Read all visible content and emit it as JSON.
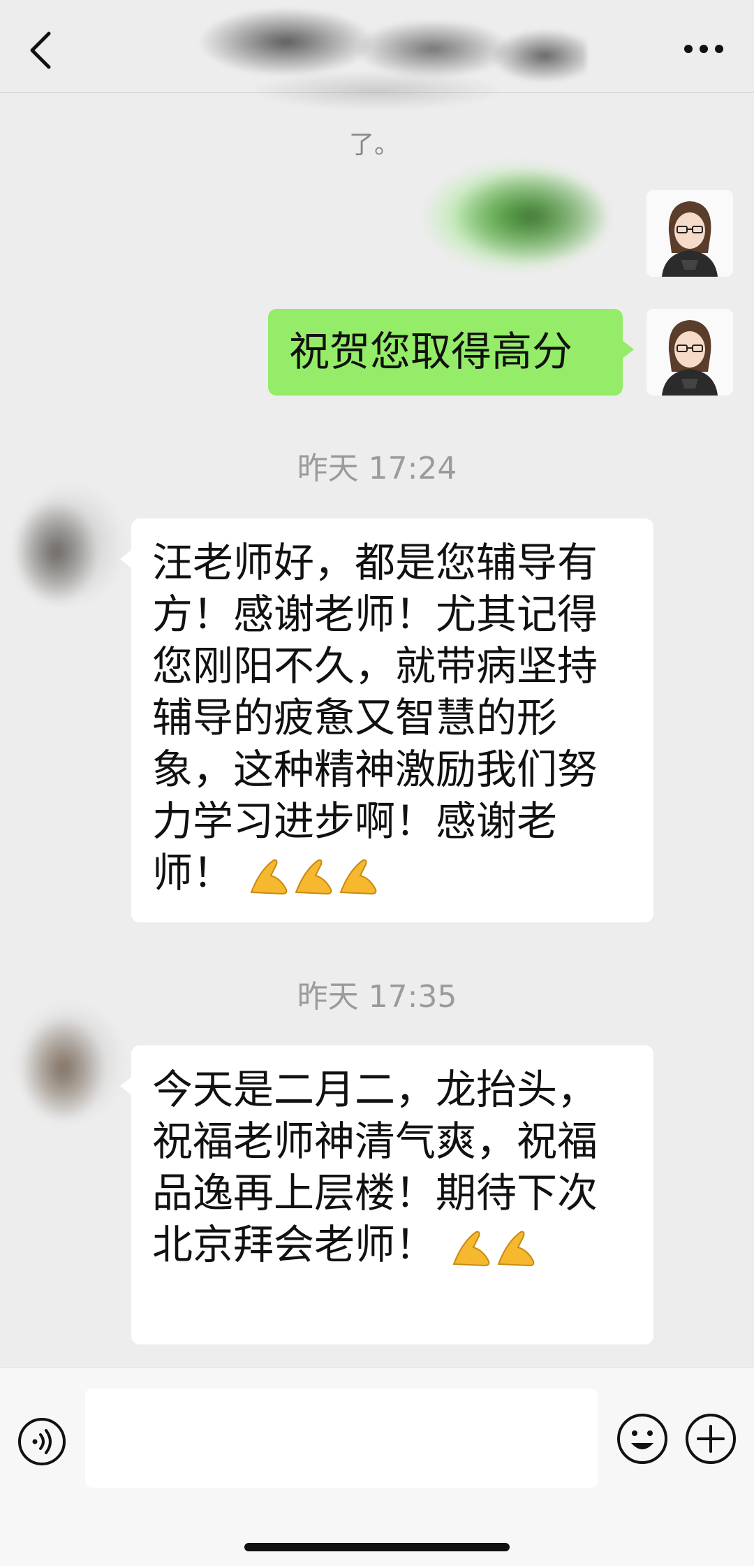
{
  "nav": {
    "back_icon": "chevron-left-icon",
    "more_icon": "more-dots-icon"
  },
  "clipped_text": "了。",
  "messages": {
    "outgoing_1_hidden_icon": "obscured-message",
    "outgoing_2": "祝贺您取得高分",
    "timestamp_1": "昨天 17:24",
    "incoming_1": "汪老师好，都是您辅导有方！感谢老师！尤其记得您刚阳不久，就带病坚持辅导的疲惫又智慧的形象，这种精神激励我们努力学习进步啊！感谢老师！",
    "timestamp_2": "昨天 17:35",
    "incoming_2": "今天是二月二，龙抬头，祝福老师神清气爽，祝福品逸再上层楼！期待下次北京拜会老师！"
  },
  "emoji": "folded-hands-emoji",
  "input_bar": {
    "voice_icon": "voice-icon",
    "emoji_icon": "smiley-icon",
    "plus_icon": "plus-icon",
    "input_value": ""
  },
  "colors": {
    "background": "#ededed",
    "outgoing_bubble": "#95ec69",
    "incoming_bubble": "#ffffff",
    "timestamp": "#9b9b9b",
    "emoji": "#f5b82e"
  }
}
